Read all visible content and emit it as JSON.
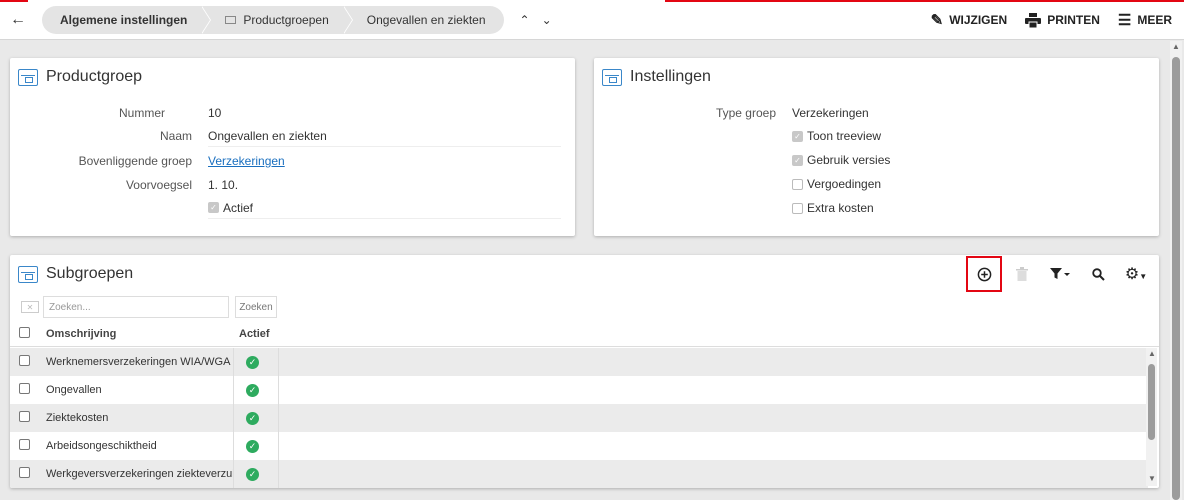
{
  "topbar": {
    "back_icon": "arrow-left-icon",
    "breadcrumbs": [
      {
        "label": "Algemene instellingen"
      },
      {
        "label": "Productgroepen"
      },
      {
        "label": "Ongevallen en ziekten"
      }
    ],
    "nav_up": "^",
    "nav_down": "⌄",
    "actions": [
      {
        "label": "WIJZIGEN",
        "icon": "pencil-icon"
      },
      {
        "label": "PRINTEN",
        "icon": "printer-icon"
      },
      {
        "label": "MEER",
        "icon": "hamburger-icon"
      }
    ],
    "accent_color": "#e30613"
  },
  "productgroep": {
    "title": "Productgroep",
    "fields": [
      {
        "label": "Nummer",
        "value": "10"
      },
      {
        "label": "Naam",
        "value": "Ongevallen en ziekten"
      },
      {
        "label": "Bovenliggende groep",
        "value": "Verzekeringen"
      },
      {
        "label": "Voorvoegsel",
        "value": "1. 10."
      }
    ],
    "actief_label": "Actief",
    "actief_checked": true
  },
  "instellingen": {
    "title": "Instellingen",
    "type_label": "Type groep",
    "type_value": "Verzekeringen",
    "options": [
      {
        "label": "Toon treeview",
        "checked": true
      },
      {
        "label": "Gebruik versies",
        "checked": true
      },
      {
        "label": "Vergoedingen",
        "checked": false
      },
      {
        "label": "Extra kosten",
        "checked": false
      }
    ]
  },
  "subgroepen": {
    "title": "Subgroepen",
    "search_placeholder": "Zoeken...",
    "search_button": "Zoeken",
    "columns": {
      "description": "Omschrijving",
      "active": "Actief"
    },
    "rows": [
      {
        "description": "Werknemersverzekeringen WIA/WGA",
        "active": true
      },
      {
        "description": "Ongevallen",
        "active": true
      },
      {
        "description": "Ziektekosten",
        "active": true
      },
      {
        "description": "Arbeidsongeschiktheid",
        "active": true
      },
      {
        "description": "Werkgeversverzekeringen ziekteverzuim",
        "active": true
      }
    ],
    "tools": [
      "add-circle-icon",
      "trash-icon",
      "filter-icon",
      "search-icon",
      "settings-gear-icon"
    ],
    "active_color": "#2eab5f"
  }
}
